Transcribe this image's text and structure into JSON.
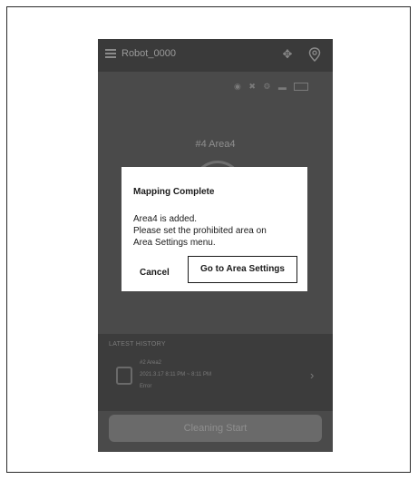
{
  "app": {
    "robot_name": "Robot_0000"
  },
  "icons": {
    "menu": "menu-icon",
    "move": "move-icon",
    "location": "location-pin-icon",
    "status": [
      "wifi-icon",
      "error-icon",
      "settings-icon",
      "battery-icon"
    ]
  },
  "main": {
    "area_title": "#4 Area4"
  },
  "dialog": {
    "title": "Mapping Complete",
    "message_lines": [
      "Area4 is added.",
      "Please set the prohibited area on",
      "Area Settings menu."
    ],
    "cancel_label": "Cancel",
    "confirm_label": "Go to Area Settings"
  },
  "history": {
    "header": "LATEST HISTORY",
    "item": {
      "area": "#2 Area2",
      "time": "2021.3.17 8:11 PM ~ 8:11 PM",
      "status": "Error"
    }
  },
  "actions": {
    "start_label": "Cleaning Start"
  },
  "colors": {
    "app_background": "#4a4a4a",
    "topbar": "#3a3a3a",
    "dialog_background": "#ffffff",
    "dialog_text": "#1a1a1a"
  }
}
